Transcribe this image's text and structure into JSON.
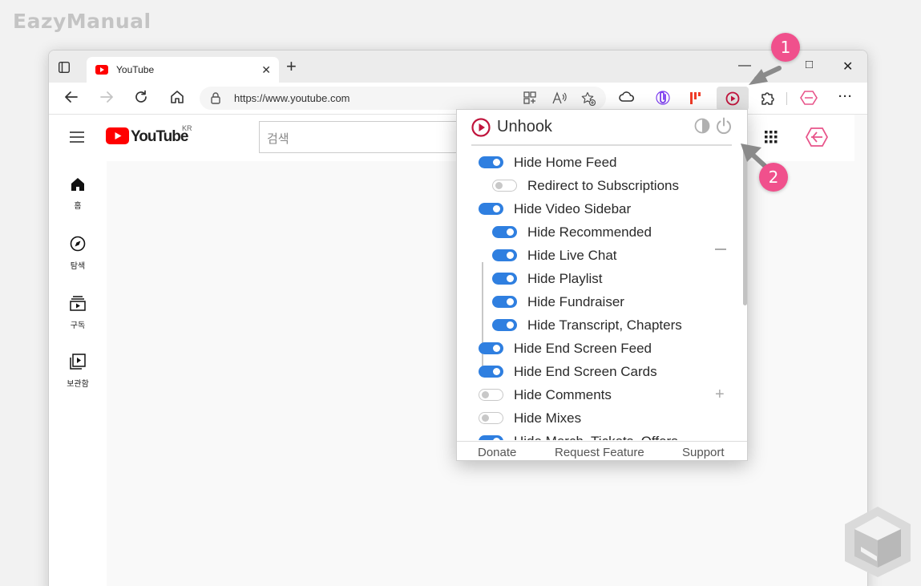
{
  "watermark": "EazyManual",
  "browser": {
    "tab": {
      "title": "YouTube",
      "close": "✕"
    },
    "new_tab": "+",
    "window_controls": {
      "minimize": "—",
      "maximize": "□",
      "close": "✕"
    },
    "address": {
      "url": "https://www.youtube.com"
    },
    "menu": "···"
  },
  "youtube": {
    "logo_text": "YouTube",
    "region": "KR",
    "search_placeholder": "검색",
    "sidebar": [
      {
        "label": "홈",
        "icon": "home-icon"
      },
      {
        "label": "탐색",
        "icon": "compass-icon"
      },
      {
        "label": "구독",
        "icon": "subscriptions-icon"
      },
      {
        "label": "보관함",
        "icon": "library-icon"
      }
    ]
  },
  "popup": {
    "title": "Unhook",
    "accent": "#c0143c",
    "options": [
      {
        "label": "Hide Home Feed",
        "on": true,
        "level": 0
      },
      {
        "label": "Redirect to Subscriptions",
        "on": false,
        "level": 1
      },
      {
        "label": "Hide Video Sidebar",
        "on": true,
        "level": 0
      },
      {
        "label": "Hide Recommended",
        "on": true,
        "level": 1
      },
      {
        "label": "Hide Live Chat",
        "on": true,
        "level": 1
      },
      {
        "label": "Hide Playlist",
        "on": true,
        "level": 1
      },
      {
        "label": "Hide Fundraiser",
        "on": true,
        "level": 1
      },
      {
        "label": "Hide Transcript, Chapters",
        "on": true,
        "level": 1
      },
      {
        "label": "Hide End Screen Feed",
        "on": true,
        "level": 0
      },
      {
        "label": "Hide End Screen Cards",
        "on": true,
        "level": 0
      },
      {
        "label": "Hide Comments",
        "on": false,
        "level": 0
      },
      {
        "label": "Hide Mixes",
        "on": false,
        "level": 0
      },
      {
        "label": "Hide Merch, Tickets, Offers",
        "on": true,
        "level": 0
      }
    ],
    "expand_symbol": "+",
    "footer": {
      "donate": "Donate",
      "request": "Request Feature",
      "support": "Support"
    }
  },
  "badges": {
    "one": "1",
    "two": "2"
  }
}
